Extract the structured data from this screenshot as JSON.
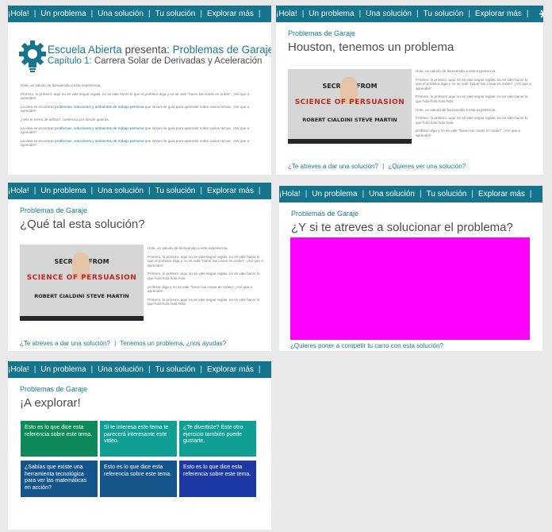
{
  "nav": [
    "¡Hola!",
    "Un problema",
    "Una solución",
    "Tu solución",
    "Explorar más"
  ],
  "nav_icon": "gear-icon",
  "colors": {
    "nav_bg": "#14758c",
    "accent": "#1b7a92",
    "placeholder_magenta": "#ff00ff",
    "tile_green": "#0d8a57",
    "tile_teal": "#109f95",
    "tile_blue": "#14558c",
    "tile_navy": "#1d3aa4"
  },
  "card1": {
    "logo_icon": "gear-lightbulb-icon",
    "title_plain": "Escuela Abierta",
    "title_mid": " presenta: ",
    "title_accent": "Problemas de Garaje",
    "chapter_label": "Capítulo 1:",
    "chapter_title": " Carrera Solar de Derivadas y Aceleración",
    "p1": "Hola, un saludo de bienvenida a esta experiencia.",
    "p2": "Primero, lo primero: aquí no se vale seguir reglas, no se vale hacer lo que el profesor diga y no se vale \"hacer las cosas en orden\". ¡Así que a aprender!",
    "p3a": "La idea es encontrar ",
    "p3b": "problemas, soluciones y ambientes de trabajo personal",
    "p3c": " que sirvan de guía para aprender sobre varios temas. ¡Así que a aprender!",
    "p4": "¿Ves el menú de arriba?, comienza por donde quieras.",
    "p5a": "La idea es encontrar ",
    "p5b": "problemas, soluciones y ambientes de trabajo personal",
    "p5c": " que sirvan de guía para aprender sobre varios temas. ¡Así que a aprender!",
    "p6a": "La idea es encontrar ",
    "p6b": "problemas, soluciones y ambientes de trabajo personal",
    "p6c": " que sirvan de guía para aprender sobre varios temas. ¡Así que a aprender!"
  },
  "video": {
    "line1": "SECRETS FROM",
    "line2": "SCIENCE OF PERSUASION",
    "line3": "ROBERT CIALDINI STEVE MARTIN"
  },
  "card2": {
    "subtitle": "Problemas de Garaje",
    "title": "Houston, tenemos un problema",
    "p1": "Hola, un saludo de bienvenida a esta experiencia.",
    "p2": "Primero, lo primero: aquí no se vale seguir reglas, no se vale hacer lo que el profesor diga y no se vale \"hacer las cosas en orden\". ¡Así que a aprender!",
    "p3": "Primero, lo primero: aquí no se vale seguir reglas, no se vale hacer lo que hola hola hola hola",
    "p4": "Hola, un saludo de bienvenida a esta experiencia.",
    "p5": "Primero, lo primero: aquí no se vale seguir reglas, no se vale hacer lo que hola hola hola hola",
    "p6": "profesor diga y no se vale \"hacer las cosas en orden\". ¡Así que a aprender!",
    "link1": "¿Te atreves a dar una solución?",
    "sep": "|",
    "link2": "¿Quieres ver una solución?"
  },
  "card3": {
    "subtitle": "Problemas de Garaje",
    "title": "¿Qué tal esta solución?",
    "p1": "Hola, un saludo de bienvenida a esta experiencia.",
    "p2": "Primero, lo primero: aquí no se vale seguir reglas, no se vale hacer lo que el profesor diga y no se vale \"hacer las cosas en orden\". ¡Así que a aprender!",
    "p3": "Primero, lo primero: aquí no se vale seguir reglas, no se vale hacer lo que hola hola hola hola",
    "p4": "profesor diga y no se vale \"hacer las cosas en orden\". ¡Así que a aprender!",
    "p5": "Primero, lo primero: aquí no se vale seguir reglas, no se vale hacer lo que hola hola hola hola",
    "link1": "¿Te atreves a dar una solución?",
    "sep": "|",
    "link2": "Tenemos un problema, ¿nos ayudas?"
  },
  "card4": {
    "subtitle": "Problemas de Garaje",
    "title": "¿Y si te atreves a solucionar el problema?",
    "link": "¿Quieres poner a competir tu carro con esta solución?"
  },
  "card5": {
    "subtitle": "Problemas de Garaje",
    "title": "¡A explorar!",
    "tiles": [
      "Esto es lo que dice esta referencia sobre este tema.",
      "Si te interesa este tema te parecerá interesante este video.",
      "¿Te divertiste? Este otro ejercicio también puede gustarte.",
      "¿Sabías que existe una herramienta tecnológica para ver las matemáticas en acción?",
      "Esto es lo que dice esta referencia sobre este tema.",
      "Esto es lo que dice esta referencia sobre este tema."
    ]
  }
}
